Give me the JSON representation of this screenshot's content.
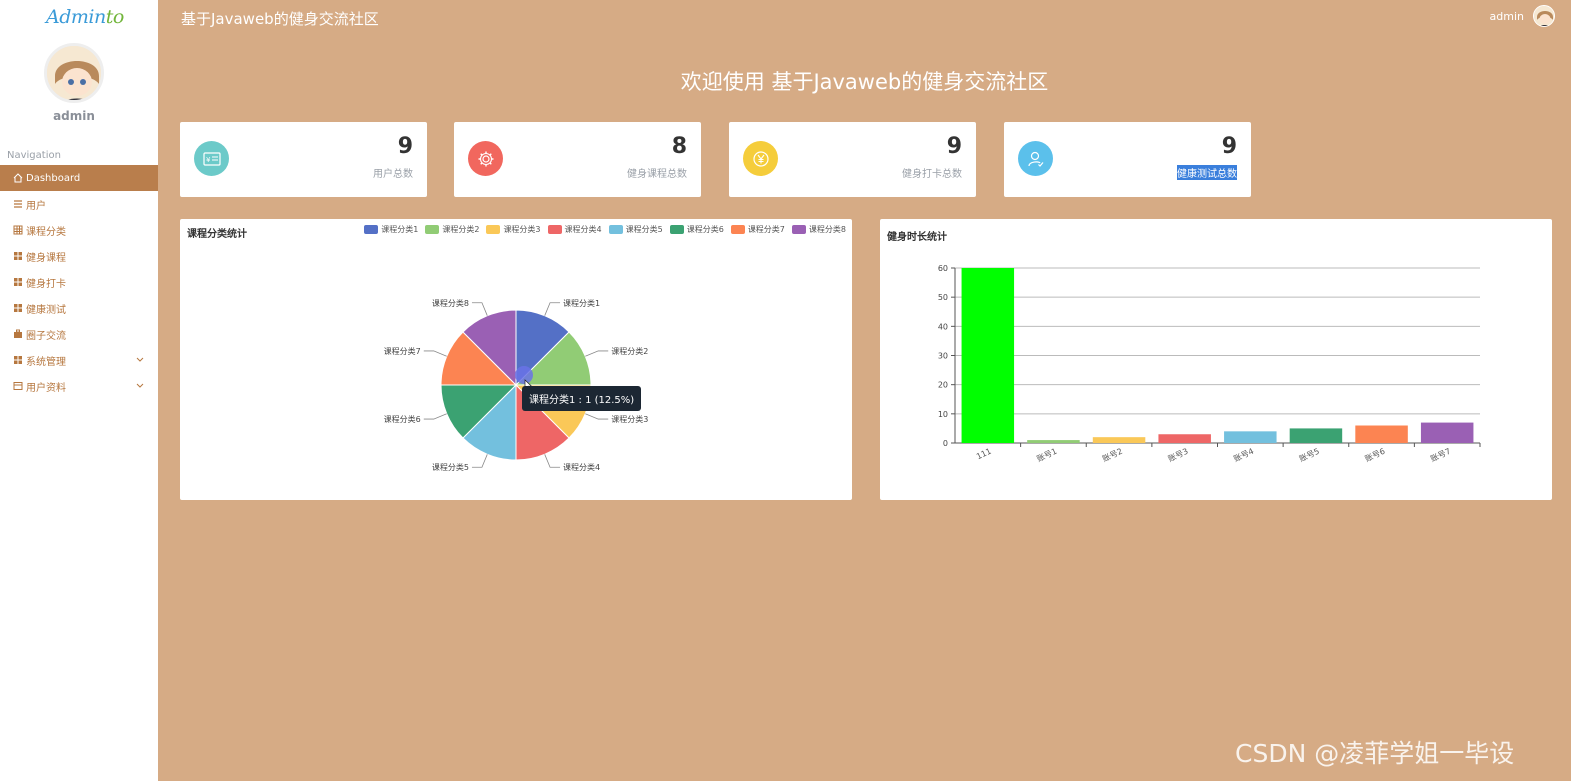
{
  "sidebar": {
    "logo_main": "Admin",
    "logo_suffix": "to",
    "username": "admin",
    "nav_heading": "Navigation",
    "items": [
      {
        "label": "Dashboard",
        "icon": "home-icon"
      },
      {
        "label": "用户",
        "icon": "list-icon"
      },
      {
        "label": "课程分类",
        "icon": "grid-icon"
      },
      {
        "label": "健身课程",
        "icon": "apps-icon"
      },
      {
        "label": "健身打卡",
        "icon": "apps-icon"
      },
      {
        "label": "健康测试",
        "icon": "apps-icon"
      },
      {
        "label": "圈子交流",
        "icon": "briefcase-icon"
      },
      {
        "label": "系统管理",
        "icon": "apps-icon"
      },
      {
        "label": "用户资料",
        "icon": "card-icon"
      }
    ]
  },
  "topbar": {
    "title": "基于Javaweb的健身交流社区",
    "user": "admin"
  },
  "welcome": "欢迎使用 基于Javaweb的健身交流社区",
  "stats": [
    {
      "value": "9",
      "label": "用户总数",
      "icon": "id-card-icon",
      "color": "#6ccac9"
    },
    {
      "value": "8",
      "label": "健身课程总数",
      "icon": "gear-icon",
      "color": "#f1675e"
    },
    {
      "value": "9",
      "label": "健身打卡总数",
      "icon": "yen-coin-icon",
      "color": "#f5cd3b"
    },
    {
      "value": "9",
      "label": "健康测试总数",
      "icon": "user-check-icon",
      "color": "#5bc0eb"
    }
  ],
  "colors": {
    "background": "#d6ab85",
    "active_menu": "#b97e4c",
    "menu_text": "#b6773f"
  },
  "chart_data": [
    {
      "type": "pie",
      "title": "课程分类统计",
      "categories": [
        "课程分类1",
        "课程分类2",
        "课程分类3",
        "课程分类4",
        "课程分类5",
        "课程分类6",
        "课程分类7",
        "课程分类8"
      ],
      "values": [
        1,
        1,
        1,
        1,
        1,
        1,
        1,
        1
      ],
      "colors": [
        "#5470c6",
        "#91cc75",
        "#fac858",
        "#ee6666",
        "#73c0de",
        "#3ba272",
        "#fc8452",
        "#9a60b4"
      ],
      "legend": "top-right",
      "tooltip": "课程分类1 : 1 (12.5%)"
    },
    {
      "type": "bar",
      "title": "健身时长统计",
      "categories": [
        "111",
        "账号1",
        "账号2",
        "账号3",
        "账号4",
        "账号5",
        "账号6",
        "账号7"
      ],
      "values": [
        60,
        1,
        2,
        3,
        4,
        5,
        6,
        7
      ],
      "colors": [
        "#00ff00",
        "#91cc75",
        "#fac858",
        "#ee6666",
        "#73c0de",
        "#3ba272",
        "#fc8452",
        "#9a60b4"
      ],
      "ylim": [
        0,
        60
      ],
      "yticks": [
        0,
        10,
        20,
        30,
        40,
        50,
        60
      ],
      "grid": true
    }
  ],
  "watermark": "CSDN @凌菲学姐一毕设"
}
